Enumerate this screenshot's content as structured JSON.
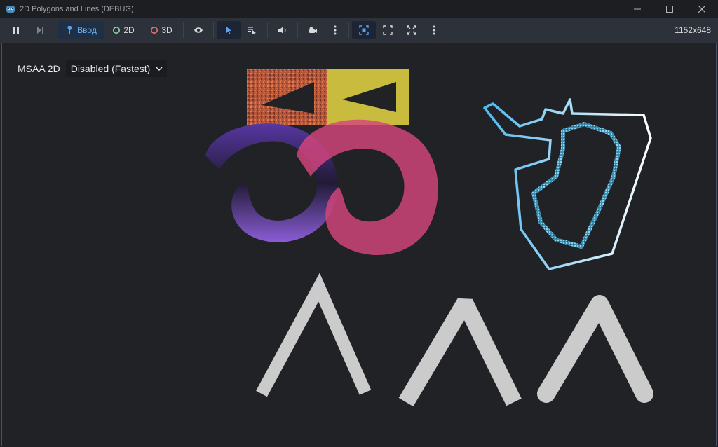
{
  "window": {
    "title": "2D Polygons and Lines (DEBUG)",
    "icons": [
      "godot-icon",
      "minimize-icon",
      "maximize-icon",
      "close-icon"
    ]
  },
  "toolbar": {
    "input_label": "Ввод",
    "mode_2d_label": "2D",
    "mode_3d_label": "3D",
    "resolution": "1152x648",
    "colors": {
      "accent": "#5ba3ef",
      "toolbar_bg": "#2d3139",
      "mode_2d": "#8ed6a0",
      "mode_3d": "#f07171"
    },
    "icons": [
      "pause-icon",
      "step-icon",
      "input-icon",
      "2d-ring-icon",
      "3d-ring-icon",
      "eye-icon",
      "select-arrow-icon",
      "list-select-icon",
      "speaker-icon",
      "camera-icon",
      "more-vertical-icon",
      "camera-override-icon",
      "screen-fit-icon",
      "screen-fill-icon",
      "more-vertical-icon"
    ]
  },
  "viewport": {
    "msaa_label": "MSAA 2D",
    "msaa_value": "Disabled (Fastest)",
    "scene_colors": {
      "background": "#202226",
      "noise_texture": "#c0603a",
      "yellow_rect": "#c8bb3e",
      "purple_spiral": "#7b4fc4",
      "pink_spiral": "#d6457c",
      "blue_outline": "#6ec8f0",
      "white_outline": "#ffffff",
      "gray_lines": "#cbcbcb"
    }
  }
}
